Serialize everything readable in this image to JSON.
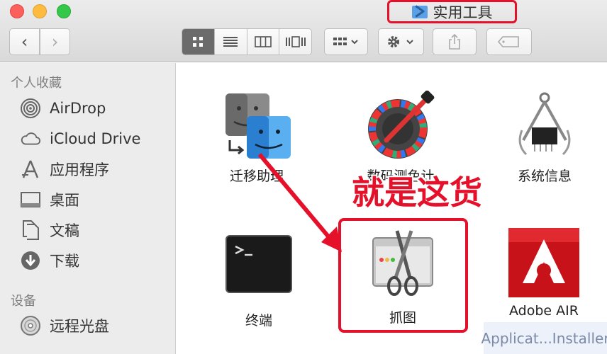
{
  "window": {
    "title": "实用工具"
  },
  "toolbar": {
    "back_glyph": "‹",
    "forward_glyph": "›",
    "views": [
      "icon-view",
      "list-view",
      "column-view",
      "coverflow-view"
    ],
    "active_view": "icon-view"
  },
  "sidebar": {
    "favorites_header": "个人收藏",
    "favorites": [
      {
        "label": "AirDrop",
        "icon": "airdrop-icon"
      },
      {
        "label": "iCloud Drive",
        "icon": "cloud-icon"
      },
      {
        "label": "应用程序",
        "icon": "applications-icon"
      },
      {
        "label": "桌面",
        "icon": "desktop-icon"
      },
      {
        "label": "文稿",
        "icon": "documents-icon"
      },
      {
        "label": "下载",
        "icon": "download-icon"
      }
    ],
    "devices_header": "设备",
    "devices": [
      {
        "label": "远程光盘",
        "icon": "disc-icon"
      }
    ]
  },
  "apps": [
    {
      "label": "迁移助理",
      "icon": "migration-assistant-icon"
    },
    {
      "label": "数码测色计",
      "icon": "digital-color-meter-icon"
    },
    {
      "label": "系统信息",
      "icon": "system-information-icon"
    },
    {
      "label": "终端",
      "icon": "terminal-icon"
    },
    {
      "label": "抓图",
      "icon": "grab-icon"
    },
    {
      "label": "Adobe AIR",
      "icon": "adobe-air-icon"
    },
    {
      "label": "Applicat...Installer",
      "icon": "adobe-air-installer-icon"
    }
  ],
  "annotation": {
    "callout": "就是这货"
  },
  "colors": {
    "highlight": "#e5102a",
    "sidebar_bg": "#ececec",
    "toolbar_bg": "#dcdcdc"
  }
}
